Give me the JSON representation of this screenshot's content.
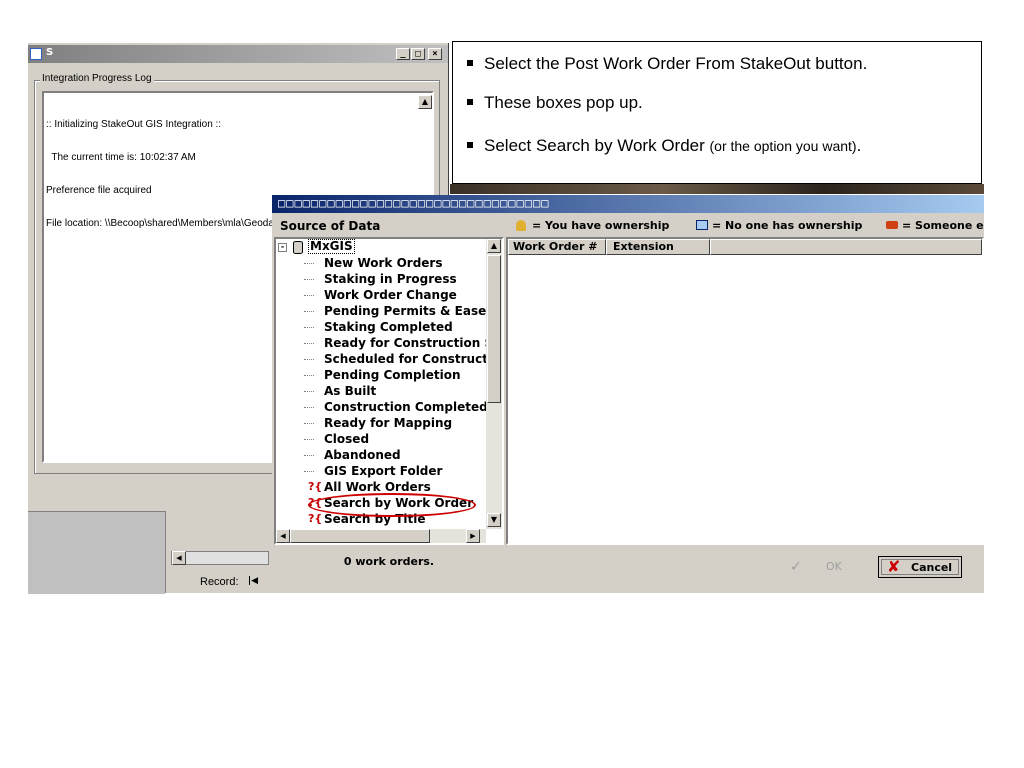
{
  "bg_window": {
    "title": "S",
    "group_title": "Integration Progress Log",
    "log_lines": [
      ":: Initializing StakeOut GIS Integration ::",
      "  The current time is: 10:02:37 AM",
      "Preference file acquired",
      "File location: \\\\Becoop\\shared\\Members\\mla\\Geodatabase\\"
    ],
    "record_label": "Record:"
  },
  "callout": {
    "bullets": [
      {
        "main": "Select the Post Work Order From StakeOut button.",
        "small": ""
      },
      {
        "main": "These boxes pop up.",
        "small": ""
      },
      {
        "main": "Select Search by Work Order ",
        "small": "(or the option you want)",
        "tail": "."
      }
    ]
  },
  "dialog": {
    "title": "□□□□□□□□□□□□□□□□□□□□□□□□□□□□□□□□□",
    "source_header": "Source of Data",
    "legend": {
      "you": "= You have ownership",
      "none": "= No one has ownership",
      "else": "= Someone else has ow"
    },
    "tree_root": "MxGIS",
    "tree_items": [
      "New Work Orders",
      "Staking in Progress",
      "Work Order Change",
      "Pending Permits & Easeme",
      "Staking Completed",
      "Ready for Construction Sc",
      "Scheduled for Constructio",
      "Pending Completion",
      "As Built",
      "Construction Completed",
      "Ready for Mapping",
      "Closed",
      "Abandoned",
      "GIS Export Folder"
    ],
    "search_items": [
      "All Work Orders",
      "Search by Work Order",
      "Search by Title"
    ],
    "highlighted_item": "Search by Work Order",
    "columns": [
      "Work Order #",
      "Extension"
    ],
    "status": "0 work orders.",
    "ok_label": "OK",
    "cancel_label": "Cancel"
  },
  "colors": {
    "title_blue": "#0a246a",
    "title_blue_light": "#a6caf0",
    "face": "#d4d0c8",
    "highlight_circle": "#cc0000"
  }
}
